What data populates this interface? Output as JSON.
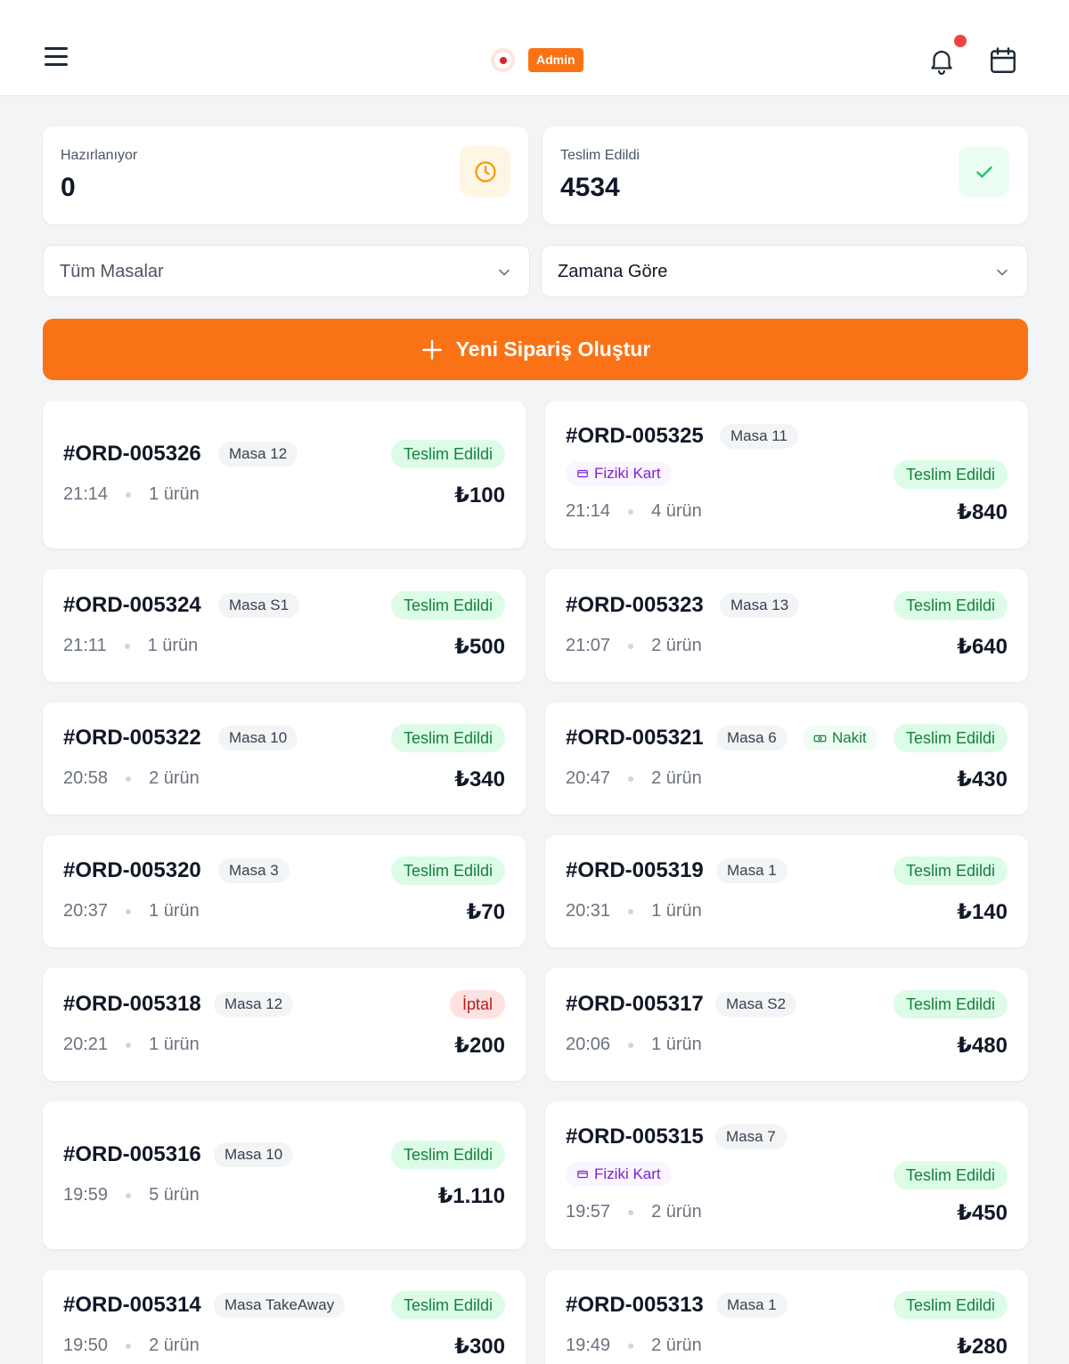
{
  "header": {
    "badge": "Admin"
  },
  "stats": [
    {
      "label": "Hazırlanıyor",
      "value": "0",
      "icon": "clock-icon",
      "color": "#f59e0b"
    },
    {
      "label": "Teslim Edildi",
      "value": "4534",
      "icon": "check-icon",
      "color": "#22c55e"
    }
  ],
  "filters": {
    "table": "Tüm Masalar",
    "sort": "Zamana Göre"
  },
  "create_button": "Yeni Sipariş Oluştur",
  "orders": [
    {
      "id": "#ORD-005326",
      "table": "Masa 12",
      "status": "Teslim Edildi",
      "time": "21:14",
      "items": "1 ürün",
      "total": "₺100"
    },
    {
      "id": "#ORD-005325",
      "table": "Masa 11",
      "payment": "Fiziki Kart",
      "status": "Teslim Edildi",
      "time": "21:14",
      "items": "4 ürün",
      "total": "₺840"
    },
    {
      "id": "#ORD-005324",
      "table": "Masa S1",
      "status": "Teslim Edildi",
      "time": "21:11",
      "items": "1 ürün",
      "total": "₺500"
    },
    {
      "id": "#ORD-005323",
      "table": "Masa 13",
      "status": "Teslim Edildi",
      "time": "21:07",
      "items": "2 ürün",
      "total": "₺640"
    },
    {
      "id": "#ORD-005322",
      "table": "Masa 10",
      "status": "Teslim Edildi",
      "time": "20:58",
      "items": "2 ürün",
      "total": "₺340"
    },
    {
      "id": "#ORD-005321",
      "table": "Masa 6",
      "payment": "Nakit",
      "status": "Teslim Edildi",
      "time": "20:47",
      "items": "2 ürün",
      "total": "₺430"
    },
    {
      "id": "#ORD-005320",
      "table": "Masa 3",
      "status": "Teslim Edildi",
      "time": "20:37",
      "items": "1 ürün",
      "total": "₺70"
    },
    {
      "id": "#ORD-005319",
      "table": "Masa 1",
      "status": "Teslim Edildi",
      "time": "20:31",
      "items": "1 ürün",
      "total": "₺140"
    },
    {
      "id": "#ORD-005318",
      "table": "Masa 12",
      "status": "İptal",
      "time": "20:21",
      "items": "1 ürün",
      "total": "₺200"
    },
    {
      "id": "#ORD-005317",
      "table": "Masa S2",
      "status": "Teslim Edildi",
      "time": "20:06",
      "items": "1 ürün",
      "total": "₺480"
    },
    {
      "id": "#ORD-005316",
      "table": "Masa 10",
      "status": "Teslim Edildi",
      "time": "19:59",
      "items": "5 ürün",
      "total": "₺1.110"
    },
    {
      "id": "#ORD-005315",
      "table": "Masa 7",
      "payment": "Fiziki Kart",
      "status": "Teslim Edildi",
      "time": "19:57",
      "items": "2 ürün",
      "total": "₺450"
    },
    {
      "id": "#ORD-005314",
      "table": "Masa TakeAway",
      "status": "Teslim Edildi",
      "time": "19:50",
      "items": "2 ürün",
      "total": "₺300"
    },
    {
      "id": "#ORD-005313",
      "table": "Masa 1",
      "status": "Teslim Edildi",
      "time": "19:49",
      "items": "2 ürün",
      "total": "₺280"
    }
  ],
  "colors": {
    "accent": "#f97316",
    "success": "#15803d",
    "danger": "#b91c1c",
    "payment_card": "#7e22ce"
  }
}
